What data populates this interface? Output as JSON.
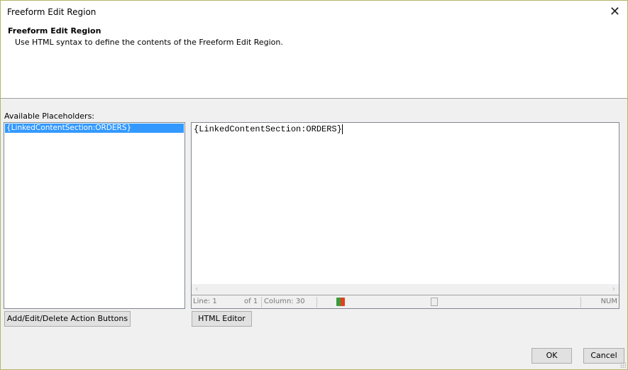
{
  "window": {
    "title": "Freeform Edit Region"
  },
  "header": {
    "title": "Freeform Edit Region",
    "description": "Use HTML syntax to define the contents of the Freeform Edit Region."
  },
  "placeholders": {
    "label": "Available Placeholders:",
    "items": [
      "{LinkedContentSection:ORDERS}"
    ]
  },
  "editor": {
    "content": "{LinkedContentSection:ORDERS}"
  },
  "status": {
    "line": "Line: 1",
    "of": "of 1",
    "column": "Column: 30",
    "num": "NUM"
  },
  "buttons": {
    "action_buttons": "Add/Edit/Delete Action Buttons",
    "html_editor": "HTML Editor",
    "ok": "OK",
    "cancel": "Cancel"
  }
}
